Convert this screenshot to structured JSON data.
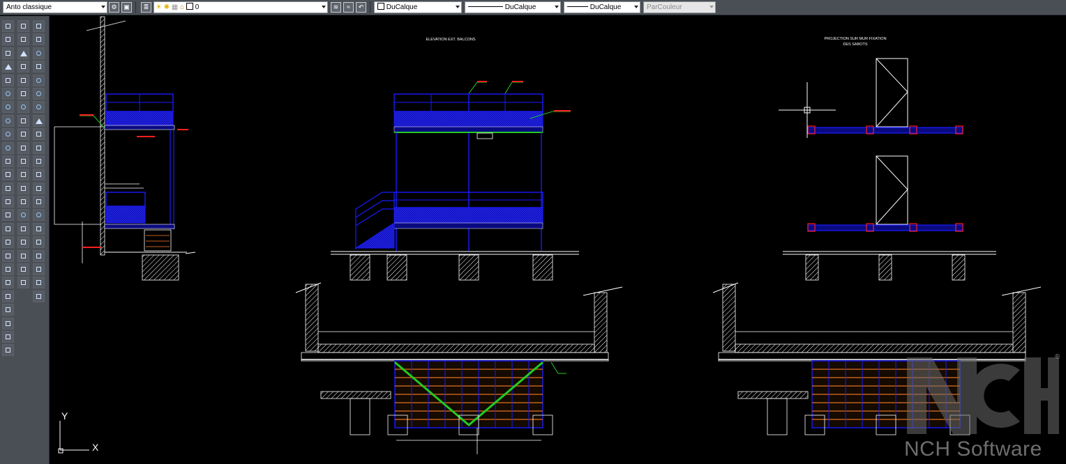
{
  "toolbar": {
    "workspace": "Anto classique",
    "layer": "0",
    "color": "DuCalque",
    "linetype": "DuCalque",
    "lineweight": "DuCalque",
    "plotstyle": "ParCouleur"
  },
  "drawing": {
    "label_elevation": "ELEVATION EXT. BALCONS",
    "label_projection_line1": "PROJECTION SUR MUR FIXATION",
    "label_projection_line2": "DES SABOTS"
  },
  "ucs": {
    "x": "X",
    "y": "Y"
  },
  "watermark": {
    "brand": "NCH Software",
    "registered": "®"
  },
  "colors": {
    "background": "#000000",
    "blue": "#1a1aff",
    "green": "#22cc22",
    "orange": "#c06020",
    "red": "#ff2020"
  }
}
